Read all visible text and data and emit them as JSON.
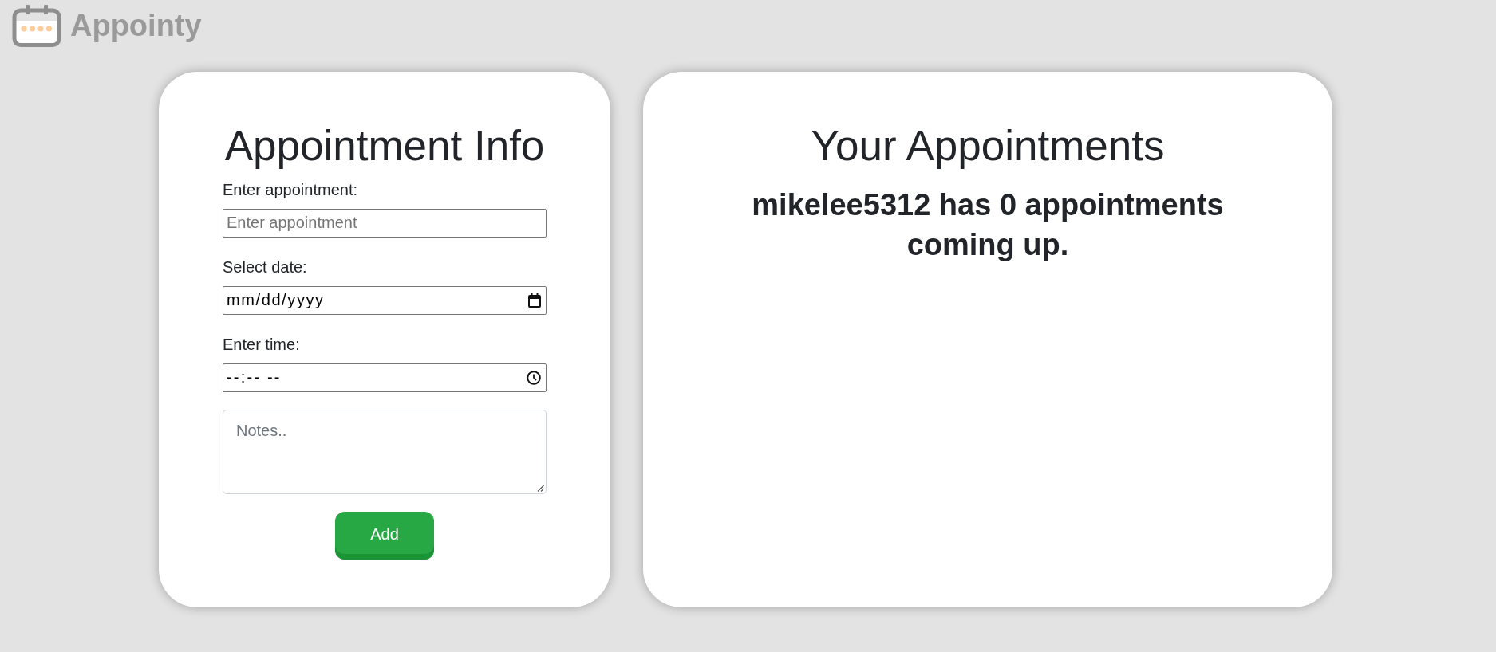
{
  "header": {
    "logo_text": "Appointy"
  },
  "form_card": {
    "title": "Appointment Info",
    "fields": [
      {
        "kind": "text",
        "label": "Enter appointment:",
        "placeholder": "Enter appointment"
      },
      {
        "kind": "date",
        "label": "Select date:",
        "placeholder": "mm/dd/yyyy"
      },
      {
        "kind": "time",
        "label": "Enter time:",
        "placeholder": "--:-- --"
      },
      {
        "kind": "notes",
        "placeholder": "Notes.."
      }
    ],
    "submit_button": "Add"
  },
  "appointments_card": {
    "title": "Your Appointments",
    "summary": "mikelee5312 has 0 appointments coming up."
  }
}
